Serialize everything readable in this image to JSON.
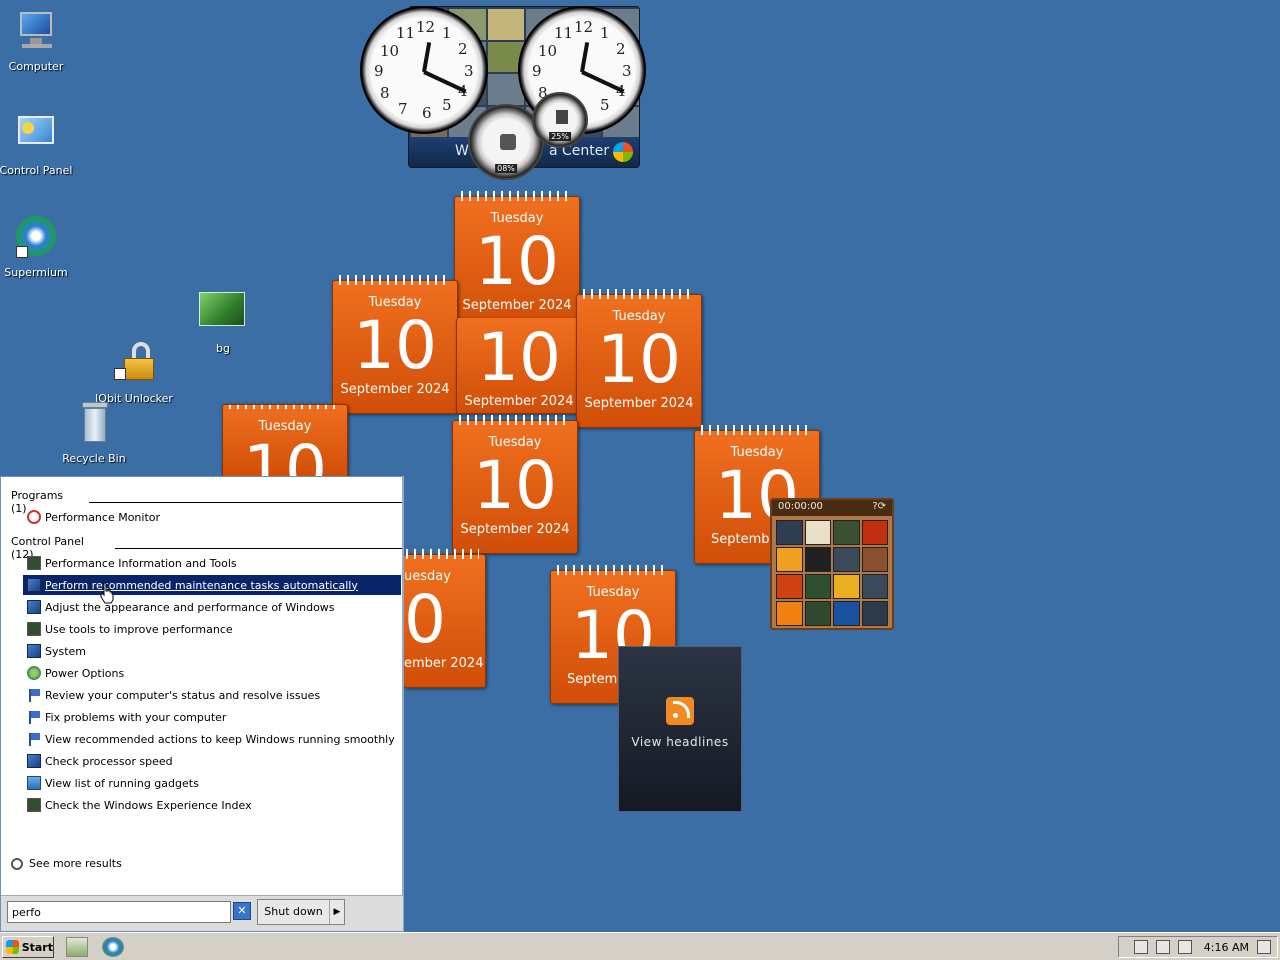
{
  "desktop_icons": [
    {
      "label": "Computer",
      "icon": "computer-icon"
    },
    {
      "label": "Control Panel",
      "icon": "control-panel-icon"
    },
    {
      "label": "Supermium",
      "icon": "supermium-icon"
    },
    {
      "label": "bg",
      "icon": "image-file-icon"
    },
    {
      "label": "IObit Unlocker",
      "icon": "iobit-unlocker-icon"
    },
    {
      "label": "Recycle Bin",
      "icon": "recycle-bin-icon"
    }
  ],
  "media_center": {
    "left_text": "W",
    "right_text": "a Center"
  },
  "cpu_meter": {
    "cpu": "08%",
    "memory": "25%"
  },
  "calendar": {
    "day": "Tuesday",
    "date": "10",
    "month_year": "September 2024"
  },
  "calendar_partial": {
    "month_year_right": "ember 2024",
    "month_left": "Septembe",
    "month_left_short": "Septemb",
    "day_right": "uesday",
    "date_right": "0"
  },
  "headlines": {
    "label": "View headlines"
  },
  "puzzle": {
    "timer": "00:00:00"
  },
  "start_menu": {
    "programs_heading": "Programs (1)",
    "programs": [
      {
        "label": "Performance Monitor",
        "icon": "perfmon-icon"
      }
    ],
    "control_panel_heading": "Control Panel (12)",
    "control_panel_items": [
      {
        "label": "Performance Information and Tools",
        "icon": "monitor-icon"
      },
      {
        "label": "Perform recommended maintenance tasks automatically",
        "icon": "system-icon",
        "selected": true
      },
      {
        "label": "Adjust the appearance and performance of Windows",
        "icon": "system-icon"
      },
      {
        "label": "Use tools to improve performance",
        "icon": "monitor-icon"
      },
      {
        "label": "System",
        "icon": "system-icon"
      },
      {
        "label": "Power Options",
        "icon": "power-icon"
      },
      {
        "label": "Review your computer's status and resolve issues",
        "icon": "flag-icon"
      },
      {
        "label": "Fix problems with your computer",
        "icon": "flag-icon"
      },
      {
        "label": "View recommended actions to keep Windows running smoothly",
        "icon": "flag-icon"
      },
      {
        "label": "Check processor speed",
        "icon": "system-icon"
      },
      {
        "label": "View list of running gadgets",
        "icon": "gadgets-icon"
      },
      {
        "label": "Check the Windows Experience Index",
        "icon": "monitor-icon"
      }
    ],
    "see_more": "See more results",
    "search_value": "perfo",
    "shutdown_label": "Shut down"
  },
  "taskbar": {
    "start_label": "Start",
    "time": "4:16 AM"
  }
}
